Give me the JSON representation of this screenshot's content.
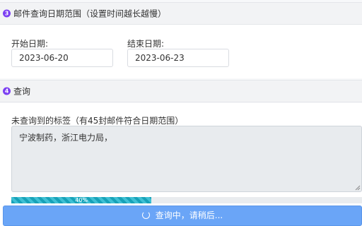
{
  "section3": {
    "number": "3",
    "title": "邮件查询日期范围（设置时间越长越慢）"
  },
  "dates": {
    "start_label": "开始日期:",
    "start_value": "2023-06-20",
    "end_label": "结束日期:",
    "end_value": "2023-06-23"
  },
  "section4": {
    "number": "4",
    "title": "查询"
  },
  "result": {
    "label": "未查询到的标签（有45封邮件符合日期范围）",
    "text": "宁波制药，浙江电力局，"
  },
  "progress": {
    "value": 0.4,
    "label": "40%"
  },
  "button": {
    "label": "查询中，请稍后..."
  },
  "colors": {
    "accent": "#7b3ff2",
    "progress": "#17a2b8",
    "button": "#6aa5f7"
  }
}
